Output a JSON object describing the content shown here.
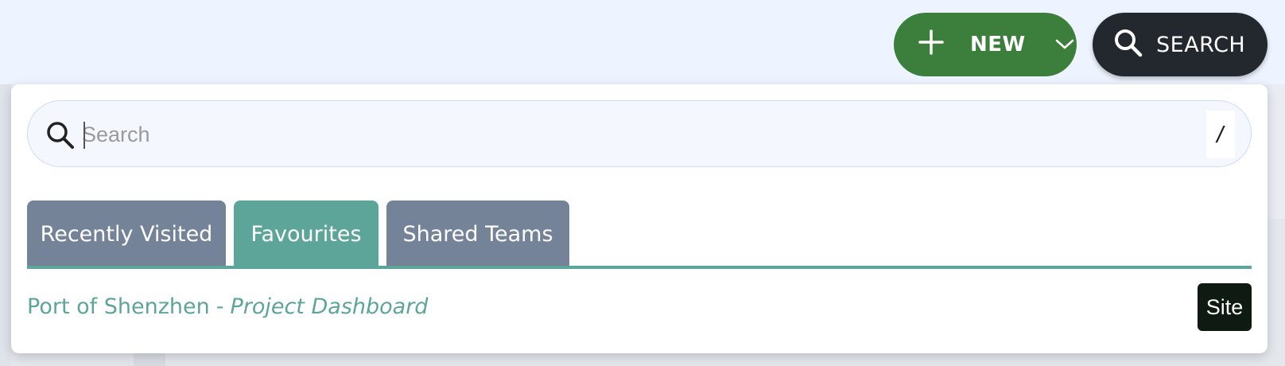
{
  "header": {
    "new_button": {
      "label": "NEW",
      "icon": "plus-icon",
      "dropdown_icon": "chevron-down-icon"
    },
    "search_button": {
      "label": "SEARCH",
      "icon": "search-icon"
    }
  },
  "search_panel": {
    "input": {
      "value": "",
      "placeholder": "Search"
    },
    "shortcut_key": "/",
    "tabs": [
      {
        "label": "Recently Visited",
        "active": false
      },
      {
        "label": "Favourites",
        "active": true
      },
      {
        "label": "Shared Teams",
        "active": false
      }
    ],
    "results": [
      {
        "site": "Port of Shenzhen",
        "separator": "-",
        "page": "Project Dashboard",
        "badge": "Site"
      }
    ]
  },
  "colors": {
    "new_button_bg": "#3c7f3d",
    "search_button_bg": "#23272e",
    "tab_active": "#5da598",
    "tab_inactive": "#748398",
    "link_text": "#5da598",
    "badge_bg": "#0f1a12"
  }
}
